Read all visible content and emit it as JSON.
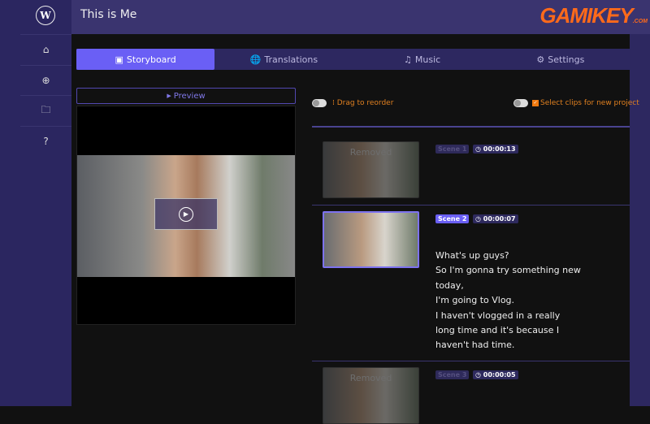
{
  "app": {
    "title": "This is Me",
    "logo_letter": "W",
    "brand_watermark": "GAMIKEY.COM"
  },
  "sidebar": {
    "items": [
      {
        "name": "home",
        "icon": "⌂"
      },
      {
        "name": "add",
        "icon": "⊕"
      },
      {
        "name": "folder",
        "icon": "🗀"
      },
      {
        "name": "help",
        "icon": "?"
      }
    ]
  },
  "tabs": [
    {
      "label": "Storyboard",
      "icon": "▣"
    },
    {
      "label": "Translations",
      "icon": "🌐"
    },
    {
      "label": "Music",
      "icon": "♫"
    },
    {
      "label": "Settings",
      "icon": "⚙"
    }
  ],
  "preview": {
    "label": "Preview",
    "icon": "▶"
  },
  "controls": {
    "drag_label": "Drag to reorder",
    "select_label": "Select clips for new project",
    "select_checked": true
  },
  "scenes": [
    {
      "label": "Scene 1",
      "time": "00:00:13",
      "removed": true,
      "removed_label": "Removed"
    },
    {
      "label": "Scene 2",
      "time": "00:00:07",
      "removed": false,
      "selected": true,
      "lines": [
        "What's up guys?",
        "So I'm gonna try something new today,",
        "I'm going to Vlog.",
        "I haven't vlogged in a really long time and it's because I haven't had time."
      ]
    },
    {
      "label": "Scene 3",
      "time": "00:00:05",
      "removed": true,
      "removed_label": "Removed"
    }
  ],
  "colors": {
    "accent": "#6a5ff5",
    "sidebar": "#2b2660",
    "orange": "#e08020"
  }
}
